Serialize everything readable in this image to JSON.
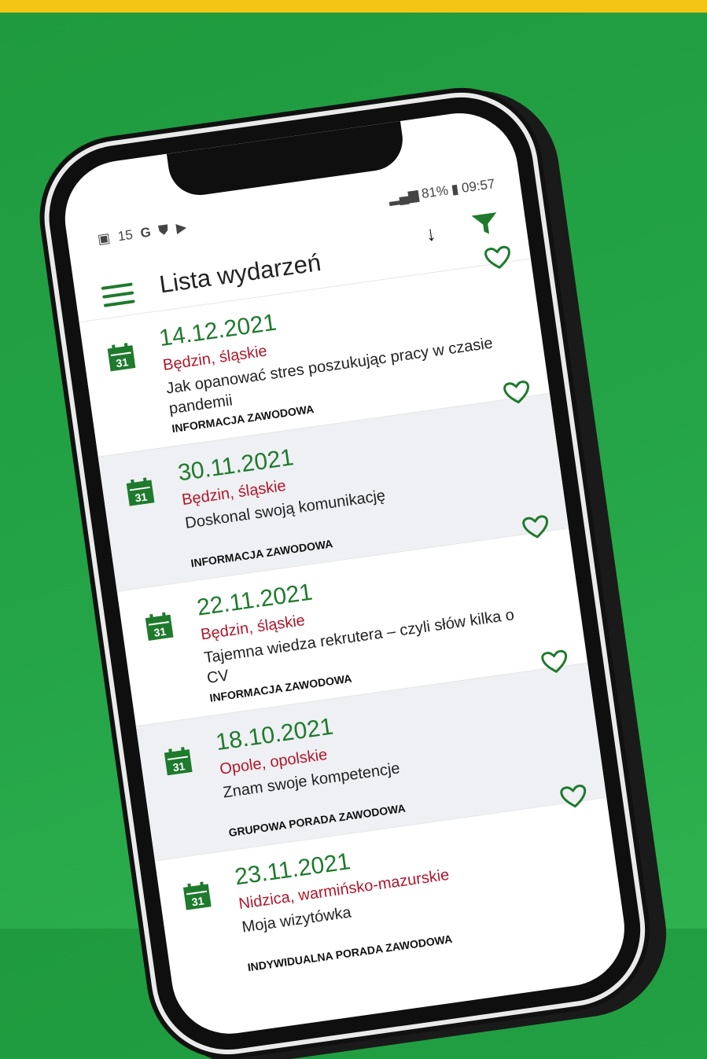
{
  "status_bar": {
    "left_icons": [
      "calendar-icon",
      "15",
      "G",
      "shield-icon",
      "play-icon"
    ],
    "battery": "81%",
    "time": "09:57"
  },
  "header": {
    "title": "Lista wydarzeń"
  },
  "events": [
    {
      "date": "14.12.2021",
      "location": "Będzin, śląskie",
      "title": "Jak opanować stres poszukując pracy w czasie pandemii",
      "category": "INFORMACJA ZAWODOWA"
    },
    {
      "date": "30.11.2021",
      "location": "Będzin, śląskie",
      "title": "Doskonal swoją komunikację",
      "category": "INFORMACJA ZAWODOWA"
    },
    {
      "date": "22.11.2021",
      "location": "Będzin, śląskie",
      "title": "Tajemna wiedza rekrutera – czyli słów kilka o CV",
      "category": "INFORMACJA ZAWODOWA"
    },
    {
      "date": "18.10.2021",
      "location": "Opole, opolskie",
      "title": "Znam swoje kompetencje",
      "category": "GRUPOWA PORADA ZAWODOWA"
    },
    {
      "date": "23.11.2021",
      "location": "Nidzica, warmińsko-mazurskie",
      "title": "Moja wizytówka",
      "category": "INDYWIDUALNA PORADA ZAWODOWA"
    }
  ],
  "calendar_icon_day": "31",
  "colors": {
    "accent": "#1e7a2c",
    "location": "#b0172b",
    "background": "#24a447",
    "top_band": "#f4c514"
  }
}
